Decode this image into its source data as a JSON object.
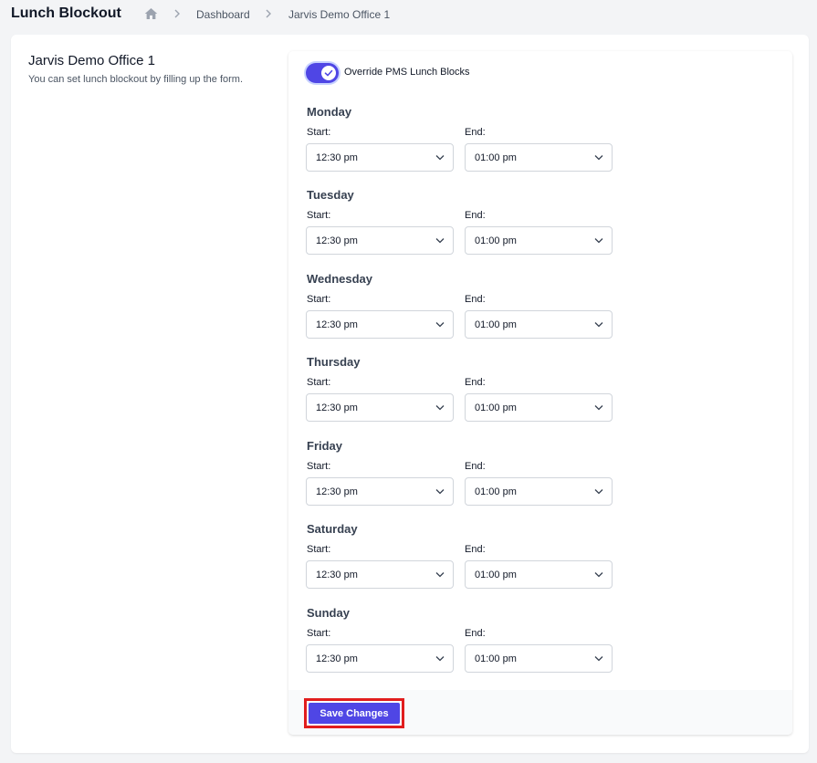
{
  "header": {
    "title": "Lunch Blockout",
    "breadcrumb": [
      "Dashboard",
      "Jarvis Demo Office 1"
    ]
  },
  "intro": {
    "title": "Jarvis Demo Office 1",
    "description": "You can set lunch blockout by filling up the form."
  },
  "form": {
    "override_label": "Override PMS Lunch Blocks",
    "override_enabled": true,
    "start_label": "Start:",
    "end_label": "End:",
    "days": [
      {
        "name": "Monday",
        "start": "12:30 pm",
        "end": "01:00 pm"
      },
      {
        "name": "Tuesday",
        "start": "12:30 pm",
        "end": "01:00 pm"
      },
      {
        "name": "Wednesday",
        "start": "12:30 pm",
        "end": "01:00 pm"
      },
      {
        "name": "Thursday",
        "start": "12:30 pm",
        "end": "01:00 pm"
      },
      {
        "name": "Friday",
        "start": "12:30 pm",
        "end": "01:00 pm"
      },
      {
        "name": "Saturday",
        "start": "12:30 pm",
        "end": "01:00 pm"
      },
      {
        "name": "Sunday",
        "start": "12:30 pm",
        "end": "01:00 pm"
      }
    ],
    "save_label": "Save Changes"
  },
  "colors": {
    "accent": "#4f46e5",
    "highlight": "#e11d1d"
  },
  "icons": {
    "home": "home-icon",
    "breadcrumb_separator": "chevron-right-icon",
    "select": "chevron-down-icon",
    "toggle": "check-icon"
  }
}
